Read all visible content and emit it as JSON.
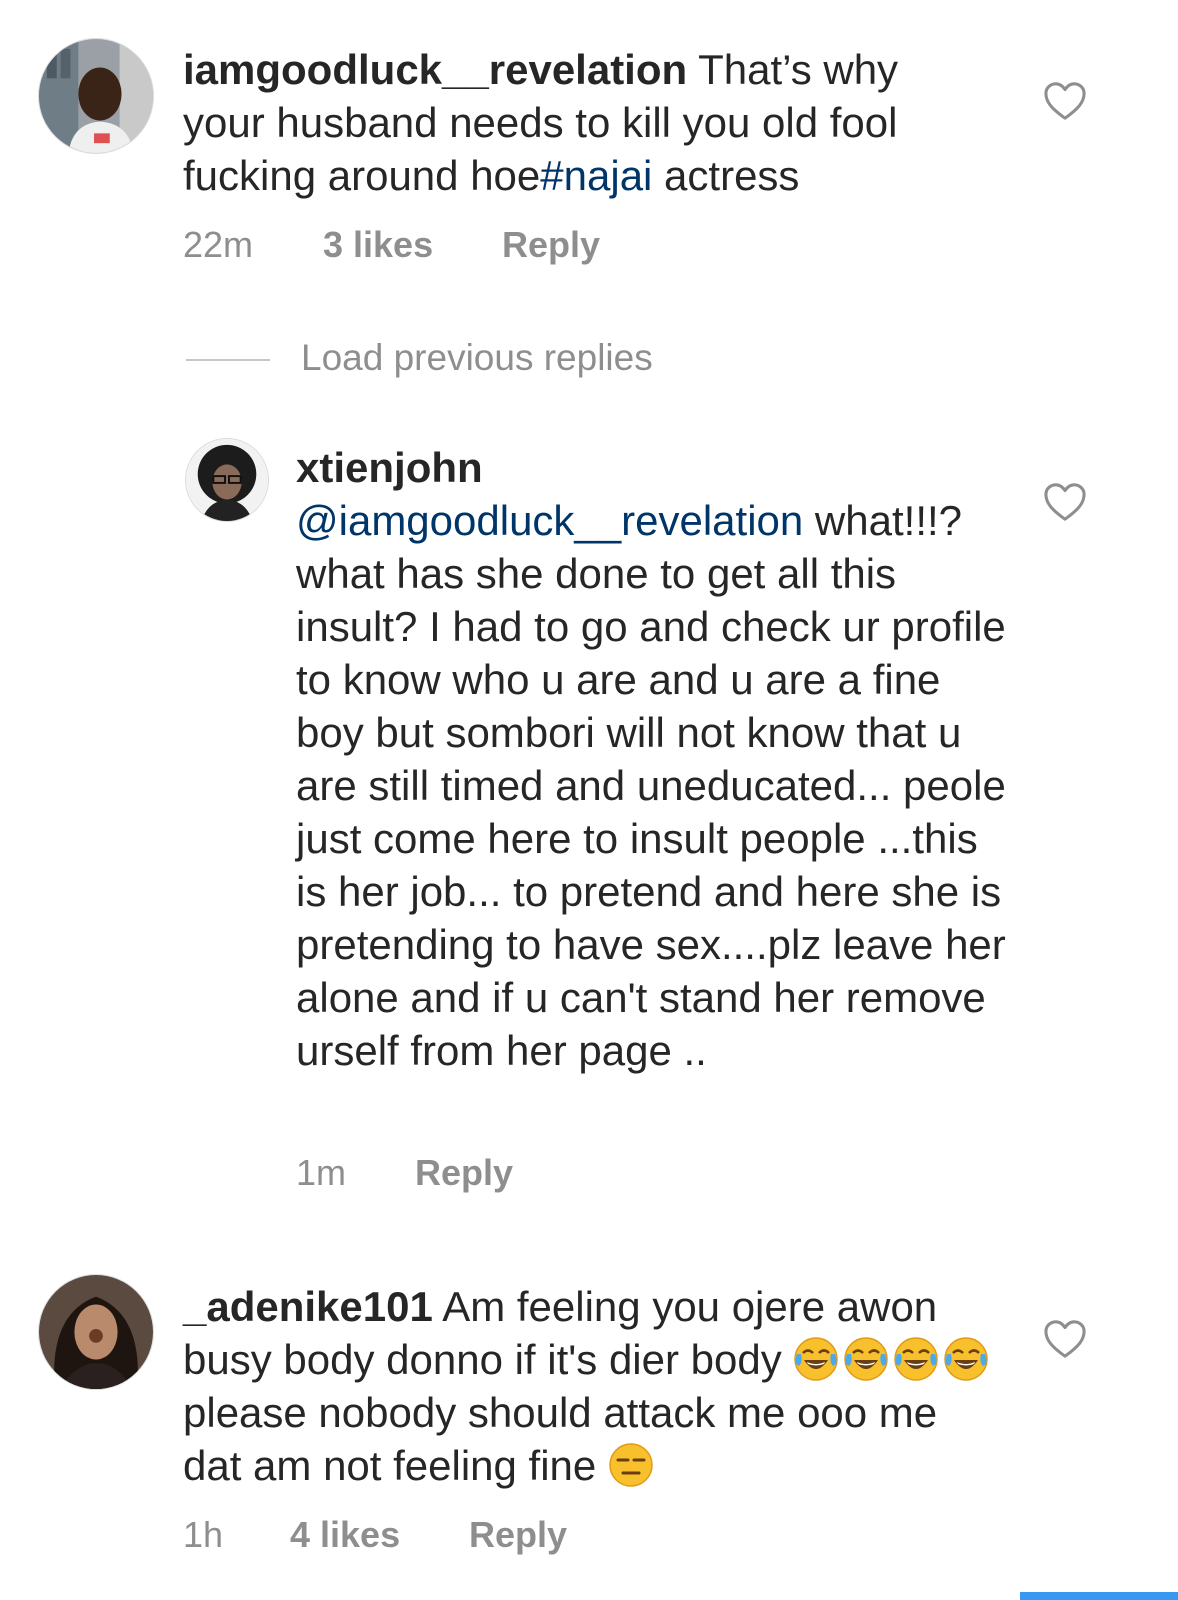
{
  "comments": [
    {
      "username": "iamgoodluck__revelation",
      "text_before": " That’s why your husband needs to kill you old fool fucking around hoe",
      "hashtag": "#najai",
      "text_after": " actress",
      "time": "22m",
      "likes": "3 likes",
      "reply_label": "Reply"
    },
    {
      "username": "_adenike101",
      "text_before": " Am feeling you ojere awon busy body donno if it's dier body ",
      "text_middle": " please nobody should attack me ooo me dat am not feeling fine ",
      "time": "1h",
      "likes": "4 likes",
      "reply_label": "Reply"
    }
  ],
  "load_previous": "Load previous replies",
  "reply": {
    "username": "xtienjohn",
    "mention": "@iamgoodluck__revelation",
    "text": " what!!!? what has she done to get all this insult? I had to go and check ur profile to know who u are and u are a fine boy but sombori will not know that u are still timed and uneducated... peole just come here to insult people ...this is her job... to pretend and here she is pretending to have sex....plz leave her alone and if u can't stand her remove urself from her page ..",
    "time": "1m",
    "reply_label": "Reply"
  },
  "icons": {
    "like": "heart-outline-icon",
    "laugh": "tears-of-joy-emoji",
    "neutral": "expressionless-face-emoji"
  },
  "colors": {
    "link": "#003569",
    "meta": "#8e8e8e",
    "text": "#262626",
    "accent": "#3897f0"
  }
}
